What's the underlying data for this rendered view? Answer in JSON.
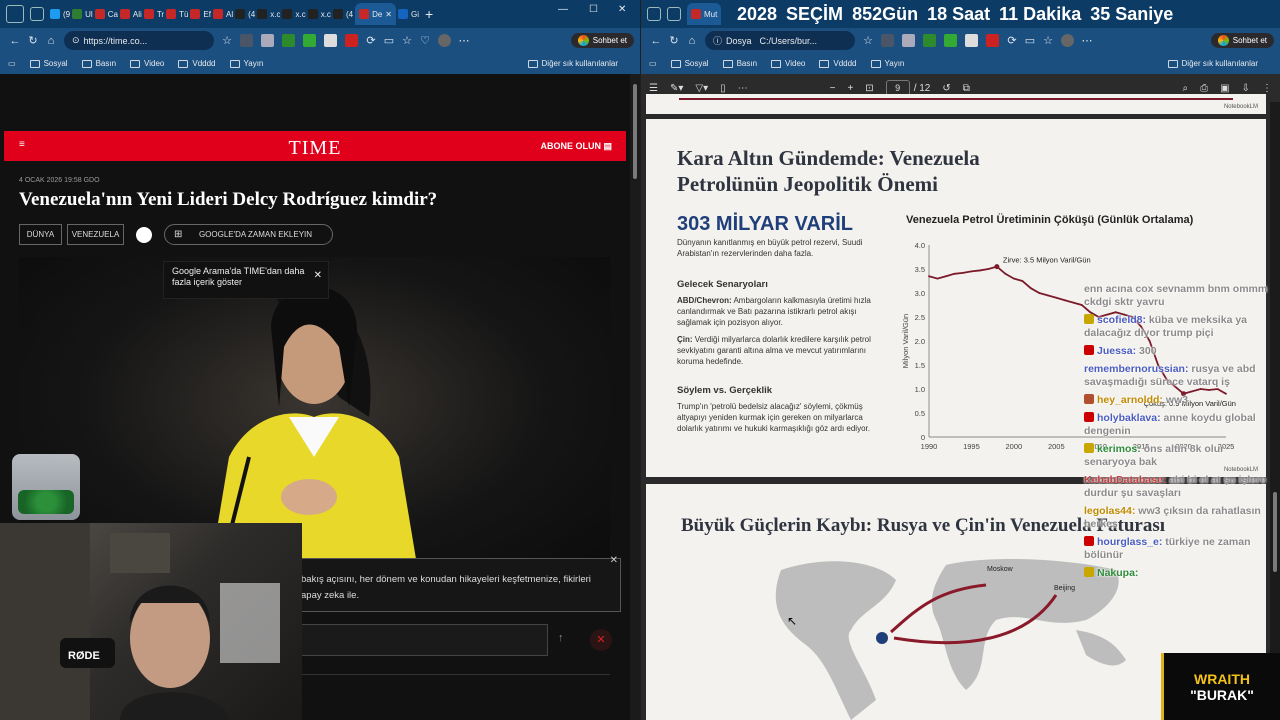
{
  "left": {
    "tabs": [
      {
        "label": "(9",
        "color": "#1d9bf0",
        "icon": "x-icon"
      },
      {
        "label": "Ul",
        "color": "#2e7d32",
        "icon": "shield-icon"
      },
      {
        "label": "Ca",
        "color": "#c62828",
        "icon": "news-icon"
      },
      {
        "label": "Ali",
        "color": "#c62828",
        "icon": "news-icon"
      },
      {
        "label": "Tr",
        "color": "#c62828",
        "icon": "news-icon"
      },
      {
        "label": "Tü",
        "color": "#c62828",
        "icon": "news-icon"
      },
      {
        "label": "Ef",
        "color": "#c62828",
        "icon": "news-icon"
      },
      {
        "label": "Al",
        "color": "#c62828",
        "icon": "news-icon"
      },
      {
        "label": "(4",
        "color": "#222",
        "icon": "x-icon"
      },
      {
        "label": "x.c",
        "color": "#222",
        "icon": "x-icon"
      },
      {
        "label": "x.c",
        "color": "#222",
        "icon": "x-icon"
      },
      {
        "label": "x.c",
        "color": "#222",
        "icon": "x-icon"
      },
      {
        "label": "(4",
        "color": "#222",
        "icon": "x-icon"
      },
      {
        "label": "De",
        "color": "#c62828",
        "icon": "time-icon",
        "active": true
      },
      {
        "label": "Gi",
        "color": "#1565c0",
        "icon": "google-icon"
      }
    ],
    "url": "https://time.co...",
    "copilot": "Sohbet et",
    "bookmarks": [
      "Sosyal",
      "Basın",
      "Video",
      "Vdddd",
      "Yayın"
    ],
    "bookmarks_other": "Diğer sık kullanılanlar",
    "time_logo": "TIME",
    "abone": "ABONE OLUN",
    "date": "4 OCAK 2026 19:58 GDO",
    "title": "Venezuela'nın Yeni Lideri Delcy Rodríguez kimdir?",
    "chips": [
      "DÜNYA",
      "VENEZUELA",
      "GOOGLE'DA ZAMAN EKLEYIN"
    ],
    "tooltip": "Google Arama'da TIME'dan daha fazla içerik göster",
    "prompt_line1": "bakış açısını, her dönem ve konudan hikayeleri keşfetmenize, fikirleri",
    "prompt_line2": "apay zeka ile.",
    "mic_label": "RØDE"
  },
  "right": {
    "countdown": {
      "year": "2028",
      "word": "SEÇİM",
      "days": "852Gün",
      "hours": "18 Saat",
      "minutes": "11 Dakika",
      "seconds": "35 Saniye"
    },
    "tab_label": "Mut",
    "file_label": "Dosya",
    "path": "C:/Users/bur...",
    "copilot": "Sohbet et",
    "bookmarks": [
      "Sosyal",
      "Basın",
      "Video",
      "Vdddd",
      "Yayın"
    ],
    "bookmarks_other": "Diğer sık kullanılanlar",
    "page_current": "9",
    "page_total": "/ 12",
    "notebooklm": "NotebookLM",
    "slide1": {
      "title": "Kara Altın Gündemde: Venezuela Petrolünün Jeopolitik Önemi",
      "big_number": "303 MİLYAR VARİL",
      "big_desc": "Dünyanın kanıtlanmış en büyük petrol rezervi, Suudi Arabistan'ın rezervlerinden daha fazla.",
      "scen_title": "Gelecek Senaryoları",
      "scen1_label": "ABD/Chevron:",
      "scen1_text": " Ambargoların kalkmasıyla üretimi hızla canlandırmak ve Batı pazarına istikrarlı petrol akışı sağlamak için pozisyon alıyor.",
      "scen2_label": "Çin:",
      "scen2_text": " Verdiği milyarlarca dolarlık kredilere karşılık petrol sevkiyatını garanti altına alma ve mevcut yatırımlarını koruma hedefinde.",
      "rhet_title": "Söylem vs. Gerçeklik",
      "rhet_text": "Trump'ın 'petrolü bedelsiz alacağız' söylemi, çökmüş altyapıyı yeniden kurmak için gereken on milyarlarca dolarlık yatırımı ve hukuki karmaşıklığı göz ardı ediyor."
    },
    "slide2": {
      "title": "Büyük Güçlerin Kaybı: Rusya ve Çin'in Venezuela Faturası",
      "moskow": "Moskow",
      "beijing": "Beijing"
    }
  },
  "chart_data": {
    "type": "line",
    "title": "Venezuela Petrol Üretiminin Çöküşü (Günlük Ortalama)",
    "ylabel": "Milyon Varil/Gün",
    "xlabel": "",
    "xlim": [
      1990,
      2025
    ],
    "ylim": [
      0,
      4.0
    ],
    "xticks": [
      1990,
      1995,
      2000,
      2005,
      2010,
      2015,
      2020,
      2025
    ],
    "yticks": [
      "0",
      "0.5",
      "1.0",
      "1.5",
      "2.0",
      "2.5",
      "3.0",
      "3.5",
      "4.0"
    ],
    "series": [
      {
        "color": "#7a1a2a",
        "x": [
          1990,
          1991,
          1992,
          1993,
          1994,
          1995,
          1996,
          1997,
          1998,
          1999,
          2000,
          2001,
          2002,
          2003,
          2004,
          2005,
          2006,
          2007,
          2008,
          2009,
          2010,
          2011,
          2012,
          2013,
          2014,
          2015,
          2016,
          2017,
          2018,
          2019,
          2020,
          2021,
          2022,
          2023,
          2024,
          2025
        ],
        "y": [
          3.35,
          3.3,
          3.35,
          3.4,
          3.42,
          3.45,
          3.47,
          3.5,
          3.55,
          3.4,
          3.3,
          3.25,
          3.1,
          3.0,
          2.95,
          2.9,
          2.85,
          2.8,
          2.75,
          2.6,
          2.5,
          2.55,
          2.6,
          2.55,
          2.5,
          2.3,
          2.0,
          1.5,
          1.2,
          1.05,
          0.9,
          0.95,
          1.0,
          0.98,
          1.0,
          0.9
        ]
      }
    ],
    "annotations": [
      {
        "text": "Zirve: 3.5 Milyon Varil/Gün",
        "x": 1998,
        "y": 3.55
      },
      {
        "text": "Çöküş: 0.9 Milyon Varil/Gün",
        "x": 2020,
        "y": 0.9
      }
    ]
  },
  "chat": [
    {
      "user": "",
      "text": "enn acına cox sevnamm bnm ommm ckdgi sktr yavru",
      "badge": "",
      "color": "#8a8a8a"
    },
    {
      "user": "scofield8:",
      "text": " küba ve meksika ya dalacağız diyor trump piçi",
      "badge": "#c8a800",
      "color": "#4a5cc0"
    },
    {
      "user": "Juessa:",
      "text": " 300",
      "badge": "#c00",
      "color": "#4a5cc0"
    },
    {
      "user": "remembernorussian:",
      "text": " rusya ve abd savaşmadığı sürece vatarq iş",
      "badge": "",
      "color": "#4a5cc0"
    },
    {
      "user": "hey_arnoldd:",
      "text": " ww3",
      "badge": "#b05030",
      "color": "#c08a00"
    },
    {
      "user": "holybaklava:",
      "text": " anne koydu global dengenin",
      "badge": "#c00",
      "color": "#4a5cc0"
    },
    {
      "user": "kerimos:",
      "text": " ons altın 8k olur senaryoya bak",
      "badge": "#c8a800",
      "color": "#2e8b3a"
    },
    {
      "user": "KebabDatabase:",
      "text": " abi bi el at şu işlere durdur şu savaşları",
      "badge": "",
      "color": "#c04040"
    },
    {
      "user": "legolas44:",
      "text": " ww3 çıksın da rahatlasın herkes",
      "badge": "",
      "color": "#c08a00"
    },
    {
      "user": "hourglass_e:",
      "text": " türkiye ne zaman bölünür",
      "badge": "#c00",
      "color": "#4a5cc0"
    },
    {
      "user": "Nakupa:",
      "text": " ",
      "badge": "#c8a800",
      "color": "#2e8b3a"
    }
  ],
  "overlay": {
    "wraith": "WRAITH",
    "burak": "\"BURAK\""
  }
}
